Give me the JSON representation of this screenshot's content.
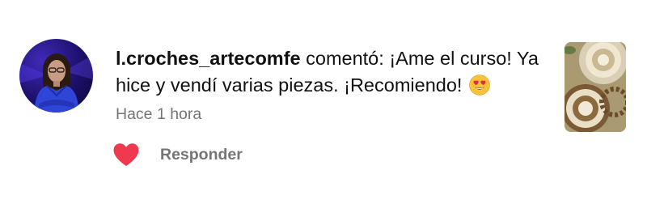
{
  "comment": {
    "username": "l.croches_artecomfe",
    "verb": " comentó: ",
    "text": "¡Ame el curso! Ya hice y vendí varias piezas. ¡Recomiendo! ",
    "emoji": "heart-eyes-emoji",
    "time": "Hace 1 hora"
  },
  "actions": {
    "like_icon": "heart-icon",
    "like_color": "#f0384f",
    "reply_label": "Responder"
  },
  "avatar": {
    "icon": "avatar"
  },
  "thumbnail": {
    "icon": "crochet-doily-thumbnail"
  },
  "colors": {
    "text": "#111111",
    "muted": "#757575",
    "background": "#ffffff"
  }
}
